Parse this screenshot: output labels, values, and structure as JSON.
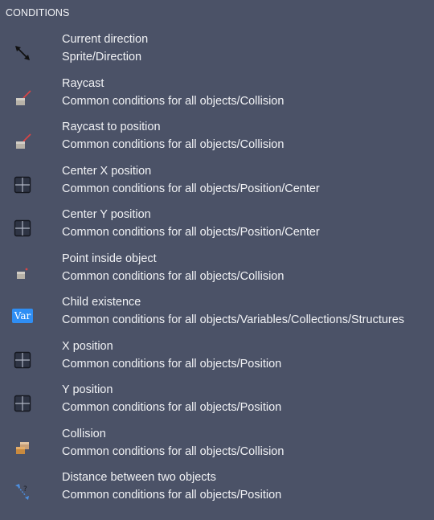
{
  "section": {
    "title": "CONDITIONS"
  },
  "items": [
    {
      "icon": "direction-arrow-icon",
      "title": "Current direction",
      "path": "Sprite/Direction"
    },
    {
      "icon": "raycast-icon",
      "title": "Raycast",
      "path": "Common conditions for all objects/Collision"
    },
    {
      "icon": "raycast-icon",
      "title": "Raycast to position",
      "path": "Common conditions for all objects/Collision"
    },
    {
      "icon": "position-grid-icon",
      "title": "Center X position",
      "path": "Common conditions for all objects/Position/Center"
    },
    {
      "icon": "position-grid-icon",
      "title": "Center Y position",
      "path": "Common conditions for all objects/Position/Center"
    },
    {
      "icon": "point-inside-icon",
      "title": "Point inside object",
      "path": "Common conditions for all objects/Collision"
    },
    {
      "icon": "var-badge-icon",
      "badge": "Var",
      "title": "Child existence",
      "path": "Common conditions for all objects/Variables/Collections/Structures"
    },
    {
      "icon": "position-grid-icon",
      "title": "X position",
      "path": "Common conditions for all objects/Position"
    },
    {
      "icon": "position-grid-icon",
      "title": "Y position",
      "path": "Common conditions for all objects/Position"
    },
    {
      "icon": "collision-icon",
      "title": "Collision",
      "path": "Common conditions for all objects/Collision"
    },
    {
      "icon": "distance-icon",
      "title": "Distance between two objects",
      "path": "Common conditions for all objects/Position"
    }
  ],
  "colors": {
    "background": "#4b5267",
    "text": "#f1f2f5",
    "var_badge": "#2f8ef4"
  }
}
